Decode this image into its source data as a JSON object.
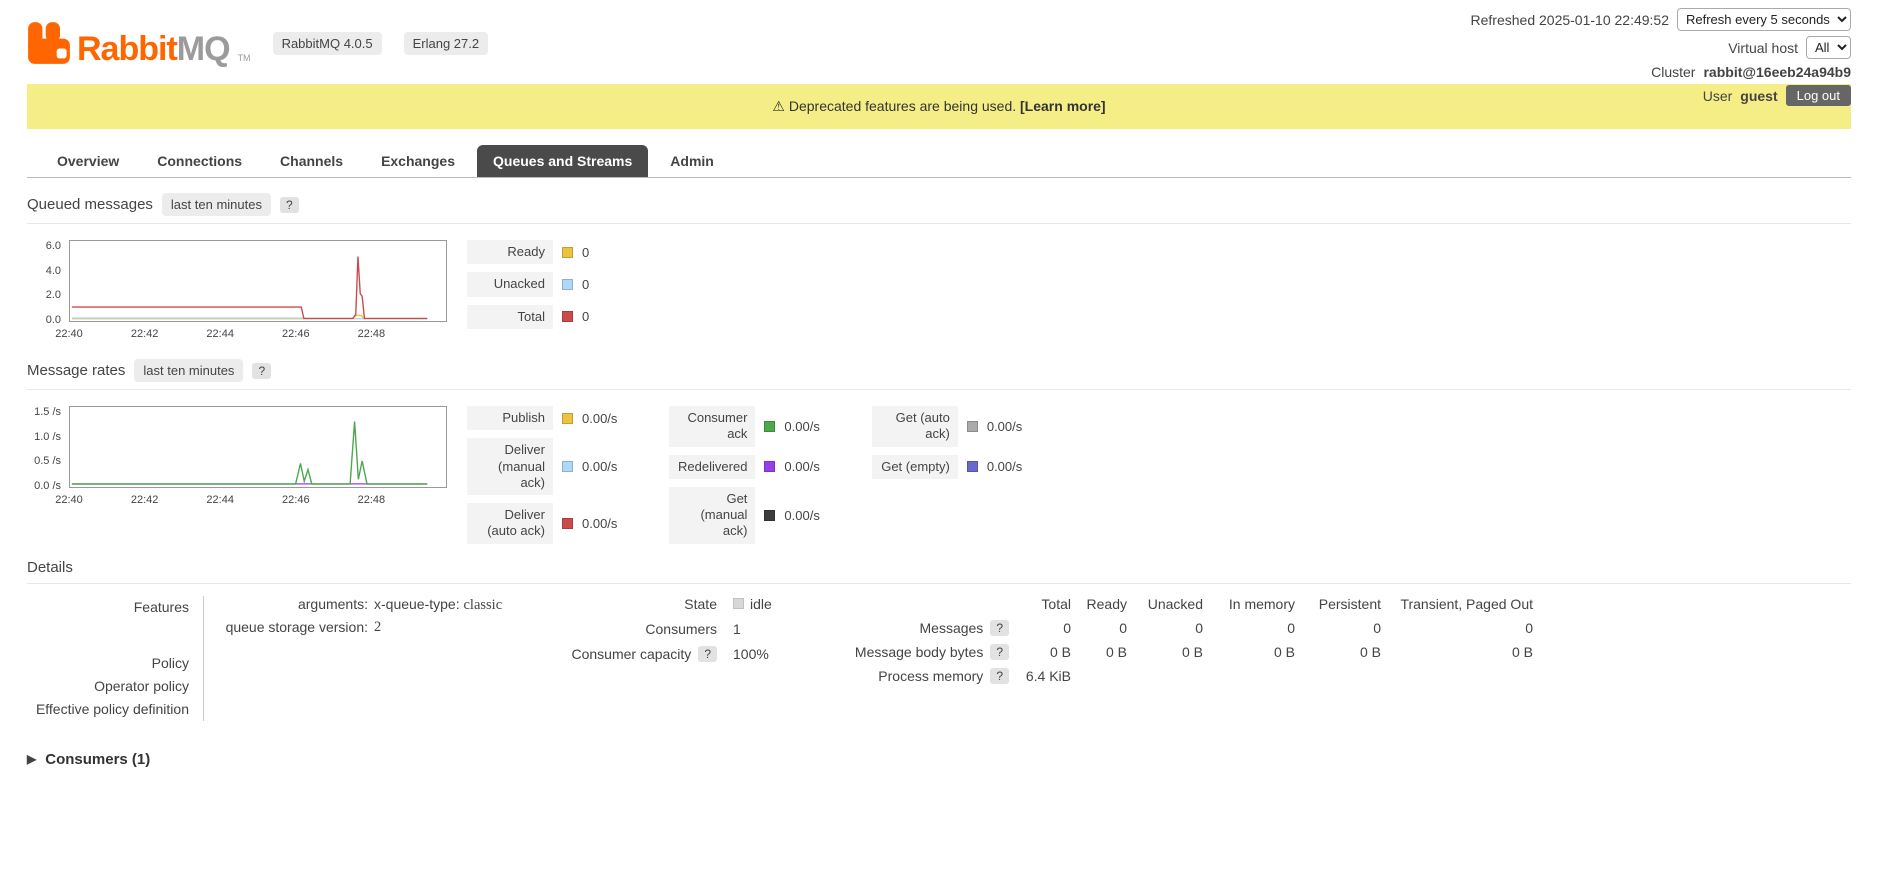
{
  "header": {
    "logo_text_rabbit": "Rabbit",
    "logo_text_mq": "MQ",
    "logo_tm": "TM",
    "version_badge": "RabbitMQ 4.0.5",
    "erlang_badge": "Erlang 27.2",
    "refreshed": "Refreshed 2025-01-10 22:49:52",
    "refresh_interval": "Refresh every 5 seconds",
    "virtual_host_label": "Virtual host",
    "virtual_host_value": "All",
    "cluster_label": "Cluster",
    "cluster_name": "rabbit@16eeb24a94b9",
    "user_label": "User",
    "user_name": "guest",
    "logout_label": "Log out",
    "brand_color": "#ff6600"
  },
  "banner": {
    "warning_icon": "⚠",
    "text": "Deprecated features are being used.",
    "link": "[Learn more]"
  },
  "tabs": [
    {
      "label": "Overview"
    },
    {
      "label": "Connections"
    },
    {
      "label": "Channels"
    },
    {
      "label": "Exchanges"
    },
    {
      "label": "Queues and Streams"
    },
    {
      "label": "Admin"
    }
  ],
  "queued_messages": {
    "title": "Queued messages",
    "range_badge": "last ten minutes",
    "help": "?",
    "legend": [
      {
        "label": "Ready",
        "color": "#edc240",
        "value": "0"
      },
      {
        "label": "Unacked",
        "color": "#afd8f8",
        "value": "0"
      },
      {
        "label": "Total",
        "color": "#cb4b4b",
        "value": "0"
      }
    ]
  },
  "message_rates": {
    "title": "Message rates",
    "range_badge": "last ten minutes",
    "help": "?",
    "legend": [
      {
        "label": "Publish",
        "color": "#edc240",
        "value": "0.00/s"
      },
      {
        "label": "Deliver (manual ack)",
        "color": "#afd8f8",
        "value": "0.00/s"
      },
      {
        "label": "Deliver (auto ack)",
        "color": "#cb4b4b",
        "value": "0.00/s"
      },
      {
        "label": "Consumer ack",
        "color": "#4da74d",
        "value": "0.00/s"
      },
      {
        "label": "Redelivered",
        "color": "#9440ed",
        "value": "0.00/s"
      },
      {
        "label": "Get (manual ack)",
        "color": "#3c3c3c",
        "value": "0.00/s"
      },
      {
        "label": "Get (auto ack)",
        "color": "#aaaaaa",
        "value": "0.00/s"
      },
      {
        "label": "Get (empty)",
        "color": "#6a67ce",
        "value": "0.00/s"
      }
    ]
  },
  "chart_data": [
    {
      "type": "line",
      "title": "Queued messages (last ten minutes)",
      "ylim": [
        0,
        6
      ],
      "yticks": [
        "6.0",
        "4.0",
        "2.0",
        "0.0"
      ],
      "xticks": [
        "22:40",
        "22:42",
        "22:44",
        "22:46",
        "22:48"
      ],
      "xtick_positions": [
        0,
        0.2,
        0.4,
        0.6,
        0.8
      ],
      "series": [
        {
          "name": "Ready",
          "color": "#edc240",
          "points": [
            [
              0.005,
              0.03
            ],
            [
              0.75,
              0.03
            ],
            [
              0.762,
              0.3
            ],
            [
              0.774,
              0.3
            ],
            [
              0.782,
              0.03
            ],
            [
              0.95,
              0.03
            ]
          ]
        },
        {
          "name": "Unacked",
          "color": "#afd8f8",
          "points": [
            [
              0.005,
              0.08
            ],
            [
              0.62,
              0.08
            ],
            [
              0.63,
              0.03
            ],
            [
              0.95,
              0.03
            ]
          ]
        },
        {
          "name": "Total",
          "color": "#cb4b4b",
          "points": [
            [
              0.005,
              1
            ],
            [
              0.615,
              1
            ],
            [
              0.622,
              0.05
            ],
            [
              0.752,
              0.05
            ],
            [
              0.76,
              0.4
            ],
            [
              0.766,
              5.2
            ],
            [
              0.772,
              2.1
            ],
            [
              0.777,
              1.9
            ],
            [
              0.783,
              0.05
            ],
            [
              0.95,
              0.05
            ]
          ]
        }
      ]
    },
    {
      "type": "line",
      "title": "Message rates (last ten minutes)",
      "ylim": [
        0,
        1.5
      ],
      "yticks": [
        "1.5 /s",
        "1.0 /s",
        "0.5 /s",
        "0.0 /s"
      ],
      "xticks": [
        "22:40",
        "22:42",
        "22:44",
        "22:46",
        "22:48"
      ],
      "xtick_positions": [
        0,
        0.2,
        0.4,
        0.6,
        0.8
      ],
      "series": [
        {
          "name": "Redelivered",
          "color": "#9440ed",
          "points": [
            [
              0.005,
              0.025
            ],
            [
              0.95,
              0.025
            ]
          ]
        },
        {
          "name": "Consumer ack",
          "color": "#4da74d",
          "points": [
            [
              0.005,
              0.02
            ],
            [
              0.6,
              0.02
            ],
            [
              0.613,
              0.45
            ],
            [
              0.623,
              0.08
            ],
            [
              0.633,
              0.32
            ],
            [
              0.643,
              0.02
            ],
            [
              0.745,
              0.02
            ],
            [
              0.757,
              1.32
            ],
            [
              0.767,
              0.12
            ],
            [
              0.777,
              0.5
            ],
            [
              0.79,
              0.02
            ],
            [
              0.95,
              0.02
            ]
          ]
        }
      ]
    }
  ],
  "details": {
    "title": "Details",
    "features_label": "Features",
    "arguments_label": "arguments:",
    "arguments_key": "x-queue-type:",
    "arguments_value": "classic",
    "storage_label": "queue storage version:",
    "storage_value": "2",
    "policy_label": "Policy",
    "operator_policy_label": "Operator policy",
    "effective_policy_label": "Effective policy definition",
    "state_label": "State",
    "state_value": "idle",
    "consumers_label": "Consumers",
    "consumers_value": "1",
    "capacity_label": "Consumer capacity",
    "capacity_help": "?",
    "capacity_value": "100%",
    "stats": {
      "headers": [
        "Total",
        "Ready",
        "Unacked",
        "In memory",
        "Persistent",
        "Transient, Paged Out"
      ],
      "rows": [
        {
          "label": "Messages",
          "help": "?",
          "values": [
            "0",
            "0",
            "0",
            "0",
            "0",
            "0"
          ]
        },
        {
          "label": "Message body bytes",
          "help": "?",
          "values": [
            "0 B",
            "0 B",
            "0 B",
            "0 B",
            "0 B",
            "0 B"
          ]
        },
        {
          "label": "Process memory",
          "help": "?",
          "values": [
            "6.4 KiB",
            "",
            "",
            "",
            "",
            ""
          ]
        }
      ]
    }
  },
  "consumers_section": {
    "arrow": "▶",
    "toggle_label": "Consumers (1)"
  }
}
